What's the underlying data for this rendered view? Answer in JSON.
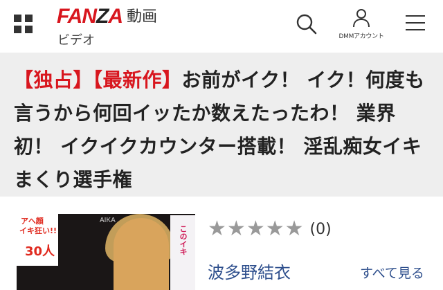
{
  "header": {
    "logo_text": "FANZA",
    "service": "動画",
    "subservice": "ビデオ",
    "account_label": "DMMアカウント",
    "icons": {
      "grid": "grid-icon",
      "search": "search-icon",
      "account": "person-icon",
      "menu": "hamburger-icon"
    }
  },
  "title": {
    "tag1": "【独占】",
    "tag2": "【最新作】",
    "text": "お前がイク！ イク！何度も言うから何回イッたか数えたったわ！ 業界初！ イクイクカウンター搭載！ 淫乱痴女イキまくり選手権"
  },
  "product": {
    "thumbnail_texts": [
      "アヘ顔",
      "イキ狂い!!",
      "30人"
    ],
    "thumbnail_brand": "AIKA",
    "thumbnail_side_text": "このイキ",
    "rating": {
      "stars_filled": 0,
      "stars_total": 5,
      "count": "(0)"
    },
    "performer": "波多野結衣",
    "see_all": "すべて見る"
  },
  "colors": {
    "brand_red": "#d8161e",
    "link_blue": "#2d4e8c",
    "band_gray": "#eeeeee",
    "star_gray": "#999999"
  }
}
